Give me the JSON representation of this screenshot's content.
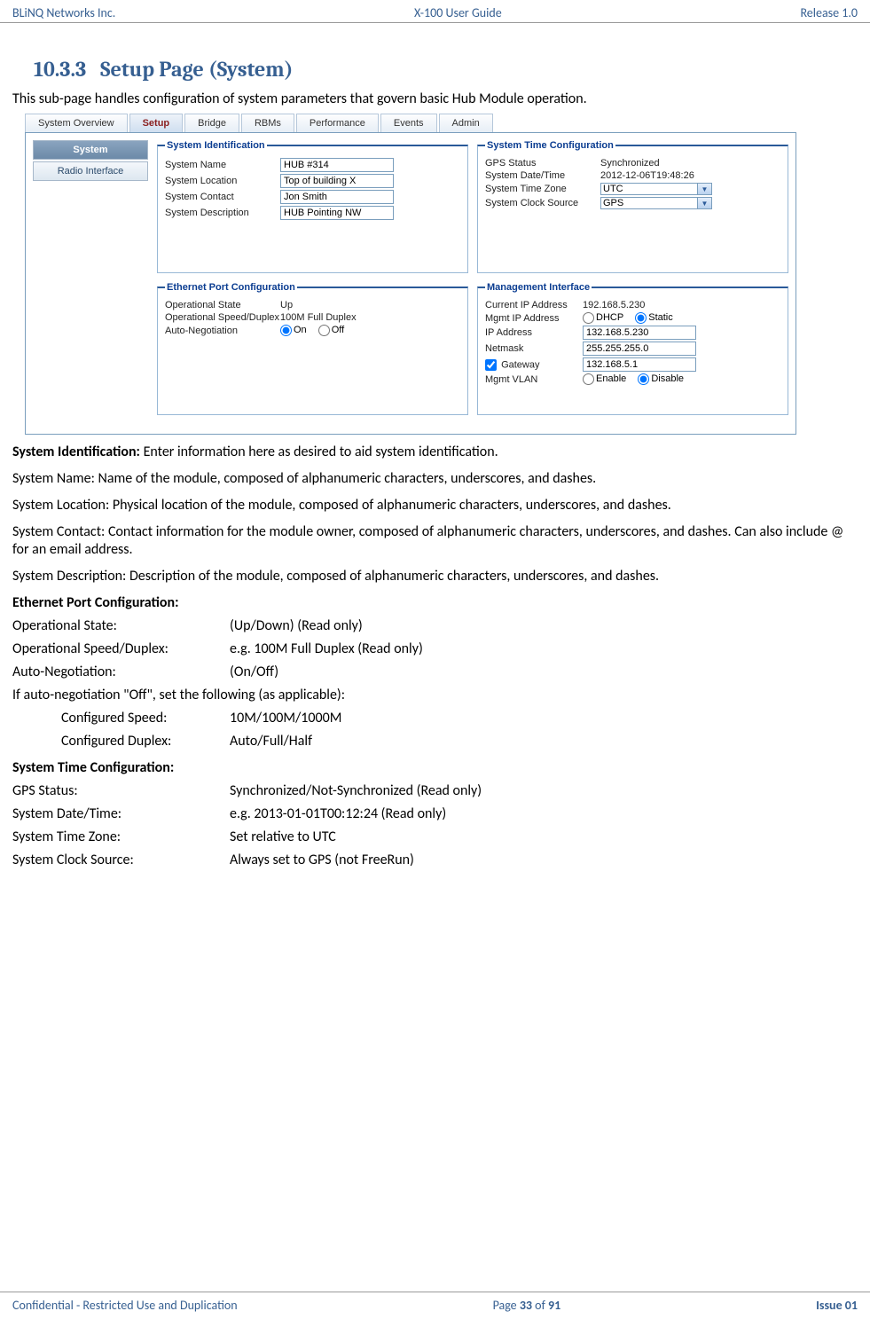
{
  "header": {
    "left": "BLiNQ Networks Inc.",
    "center": "X-100 User Guide",
    "right": "Release 1.0"
  },
  "footer": {
    "left": "Confidential - Restricted Use and Duplication",
    "center_prefix": "Page ",
    "page_num": "33",
    "center_mid": " of ",
    "page_total": "91",
    "right": "Issue 01"
  },
  "section": {
    "number": "10.3.3",
    "title": "Setup Page (System)",
    "intro": "This sub-page handles configuration of system parameters that govern basic Hub Module operation."
  },
  "screenshot": {
    "tabs": [
      "System Overview",
      "Setup",
      "Bridge",
      "RBMs",
      "Performance",
      "Events",
      "Admin"
    ],
    "selected_tab": "Setup",
    "sidebar": {
      "system": "System",
      "radio": "Radio Interface"
    },
    "sys_id": {
      "legend": "System Identification",
      "name_lbl": "System Name",
      "name_val": "HUB #314",
      "loc_lbl": "System Location",
      "loc_val": "Top of building X",
      "contact_lbl": "System Contact",
      "contact_val": "Jon Smith",
      "desc_lbl": "System Description",
      "desc_val": "HUB Pointing NW"
    },
    "sys_time": {
      "legend": "System Time Configuration",
      "gps_lbl": "GPS Status",
      "gps_val": "Synchronized",
      "dt_lbl": "System Date/Time",
      "dt_val": "2012-12-06T19:48:26",
      "tz_lbl": "System Time Zone",
      "tz_val": "UTC",
      "clk_lbl": "System Clock Source",
      "clk_val": "GPS"
    },
    "eth": {
      "legend": "Ethernet Port Configuration",
      "op_state_lbl": "Operational State",
      "op_state_val": "Up",
      "speed_lbl": "Operational Speed/Duplex",
      "speed_val": "100M Full Duplex",
      "auto_lbl": "Auto-Negotiation",
      "on": "On",
      "off": "Off"
    },
    "mgmt": {
      "legend": "Management Interface",
      "cur_ip_lbl": "Current IP Address",
      "cur_ip_val": "192.168.5.230",
      "mip_lbl": "Mgmt IP Address",
      "dhcp": "DHCP",
      "static": "Static",
      "ip_lbl": "IP Address",
      "ip_val": "132.168.5.230",
      "mask_lbl": "Netmask",
      "mask_val": "255.255.255.0",
      "gw_lbl": "Gateway",
      "gw_val": "132.168.5.1",
      "vlan_lbl": "Mgmt VLAN",
      "enable": "Enable",
      "disable": "Disable"
    }
  },
  "desc": {
    "sys_id_head": "System Identification: ",
    "sys_id_text": "Enter information here as desired to aid system identification.",
    "name": "System Name:  Name of the module, composed of alphanumeric characters, underscores, and dashes.",
    "loc": "System Location: Physical location of the module, composed of alphanumeric characters, underscores, and dashes.",
    "contact": "System Contact: Contact information for the module owner, composed of alphanumeric characters, underscores, and dashes. Can also include @ for an email address.",
    "descr": "System Description: Description of the module, composed of alphanumeric characters, underscores, and dashes.",
    "eth_head": "Ethernet Port Configuration:",
    "eth_rows": {
      "r1l": "Operational State:",
      "r1v": "(Up/Down) (Read only)",
      "r2l": "Operational Speed/Duplex:",
      "r2v": "e.g. 100M Full Duplex  (Read only)",
      "r3l": "Auto-Negotiation:",
      "r3v": "(On/Off)",
      "note": "If auto-negotiation \"Off\", set the following (as applicable):",
      "r4l": "Configured Speed:",
      "r4v": "10M/100M/1000M",
      "r5l": "Configured Duplex:",
      "r5v": "Auto/Full/Half"
    },
    "time_head": "System Time Configuration:",
    "time_rows": {
      "r1l": "GPS Status:",
      "r1v": "Synchronized/Not-Synchronized (Read only)",
      "r2l": "System Date/Time:",
      "r2v": "e.g. 2013-01-01T00:12:24 (Read only)",
      "r3l": "System Time Zone:",
      "r3v": "Set relative to UTC",
      "r4l": "System Clock Source:",
      "r4v": "Always set to GPS (not FreeRun)"
    }
  }
}
